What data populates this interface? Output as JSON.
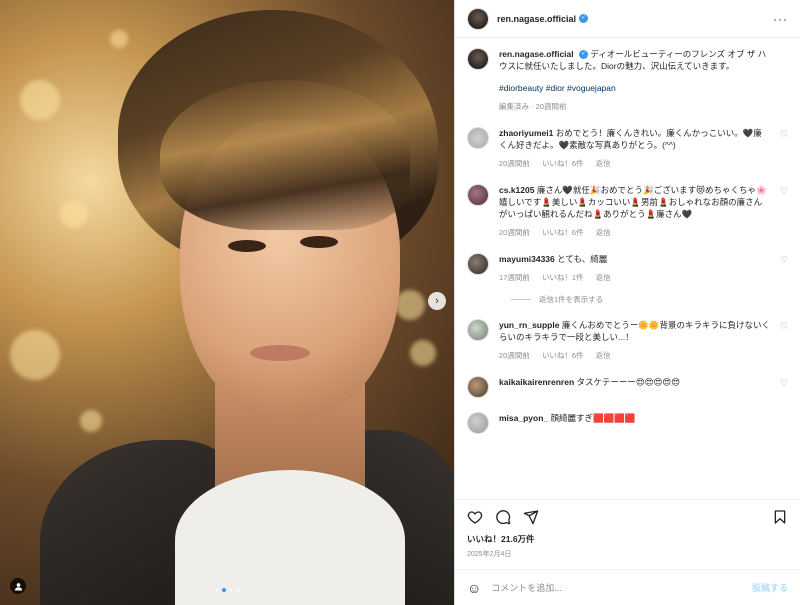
{
  "post": {
    "username": "ren.nagase.official",
    "caption": "ディオールビューティーのフレンズ オブ ザ ハウスに就任いたしました。Diorの魅力、沢山伝えていきます。",
    "hashtags": "#diorbeauty #dior #voguejapan",
    "caption_meta": "編集済み · 20週間前",
    "likes": "いいね！21.6万件",
    "date": "2025年2月4日",
    "photo_index": 2,
    "photo_total": 4
  },
  "comments": [
    {
      "user": "zhaoriyumei1",
      "text": "おめでとう！廉くんきれい。廉くんかっこいい。🖤廉くん好きだよ。🖤素敵な写真ありがとう。(^^)",
      "age": "20週間前",
      "likes": "いいね！6件",
      "reply": "返信"
    },
    {
      "user": "cs.k1205",
      "text": "廉さん🖤就任🎉おめでとう🎉ございます😻めちゃくちゃ🌸嬉しいです💄美しい💄カッコいい💄男前💄おしゃれなお顔の廉さんがいっぱい観れるんだね💄ありがとう💄廉さん🖤",
      "age": "20週間前",
      "likes": "いいね！6件",
      "reply": "返信"
    },
    {
      "user": "mayumi34336",
      "text": "とても、綺麗",
      "age": "17週間前",
      "likes": "いいね！1件",
      "reply": "返信"
    },
    {
      "user": "yun_rn_supple",
      "text": "廉くんおめでとうー🌼🌼背景のキラキラに負けないくらいのキラキラで一段と美しい...！",
      "age": "20週間前",
      "likes": "いいね！6件",
      "reply": "返信"
    },
    {
      "user": "kaikaikairenrenren",
      "text": "タスケテーーー😍😍😍😍😍",
      "age": "",
      "likes": "",
      "reply": ""
    },
    {
      "user": "misa_pyon_",
      "text": "顔綺麗すぎ🟥🟥🟥🟥",
      "age": "",
      "likes": "",
      "reply": ""
    }
  ],
  "replies_toggle": "返信1件を表示する",
  "comment_box": {
    "placeholder": "コメントを追加...",
    "post_label": "投稿する"
  },
  "icons": {
    "more": "more-options-icon",
    "heart": "heart-icon",
    "comment": "comment-icon",
    "share": "share-icon",
    "bookmark": "bookmark-icon",
    "emoji": "emoji-icon",
    "next": "chevron-right-icon",
    "user_tag": "user-tag-icon"
  },
  "colors": {
    "link": "#00376b",
    "verified": "#3897f0",
    "muted": "#8e8e8e",
    "post_btn": "#b2dffc"
  }
}
